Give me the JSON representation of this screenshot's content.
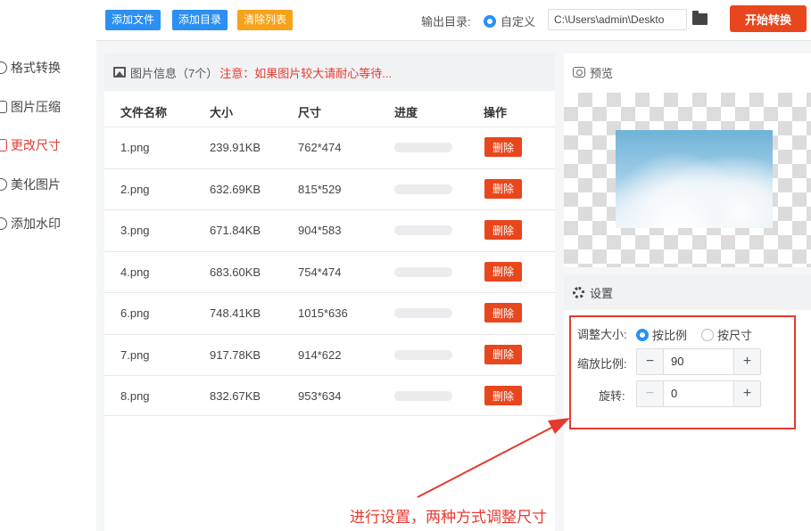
{
  "sidebar": {
    "items": [
      {
        "label": "格式转换",
        "active": false
      },
      {
        "label": "图片压缩",
        "active": false
      },
      {
        "label": "更改尺寸",
        "active": true
      },
      {
        "label": "美化图片",
        "active": false
      },
      {
        "label": "添加水印",
        "active": false
      }
    ]
  },
  "toolbar": {
    "add_file": "添加文件",
    "add_dir": "添加目录",
    "clear_list": "清除列表",
    "output_label": "输出目录:",
    "custom_label": "自定义",
    "output_path": "C:\\Users\\admin\\Deskto",
    "start_label": "开始转换"
  },
  "file_panel": {
    "title": "图片信息（7个）",
    "warning": "注意：如果图片较大请耐心等待...",
    "columns": [
      "文件名称",
      "大小",
      "尺寸",
      "进度",
      "操作"
    ],
    "delete_label": "删除",
    "rows": [
      {
        "name": "1.png",
        "size": "239.91KB",
        "dim": "762*474",
        "progress": 0
      },
      {
        "name": "2.png",
        "size": "632.69KB",
        "dim": "815*529",
        "progress": 0
      },
      {
        "name": "3.png",
        "size": "671.84KB",
        "dim": "904*583",
        "progress": 0
      },
      {
        "name": "4.png",
        "size": "683.60KB",
        "dim": "754*474",
        "progress": 0
      },
      {
        "name": "6.png",
        "size": "748.41KB",
        "dim": "1015*636",
        "progress": 0
      },
      {
        "name": "7.png",
        "size": "917.78KB",
        "dim": "914*622",
        "progress": 0
      },
      {
        "name": "8.png",
        "size": "832.67KB",
        "dim": "953*634",
        "progress": 0
      }
    ]
  },
  "preview": {
    "title": "预览"
  },
  "settings": {
    "title": "设置",
    "resize_label": "调整大小:",
    "by_ratio": "按比例",
    "by_size": "按尺寸",
    "scale_label": "缩放比例:",
    "scale_value": "90",
    "rotate_label": "旋转:",
    "rotate_value": "0"
  },
  "annotation": {
    "text": "进行设置，两种方式调整尺寸"
  },
  "colors": {
    "accent": "#2b8ff3",
    "danger": "#e8461d",
    "warn": "#f7a21b"
  }
}
